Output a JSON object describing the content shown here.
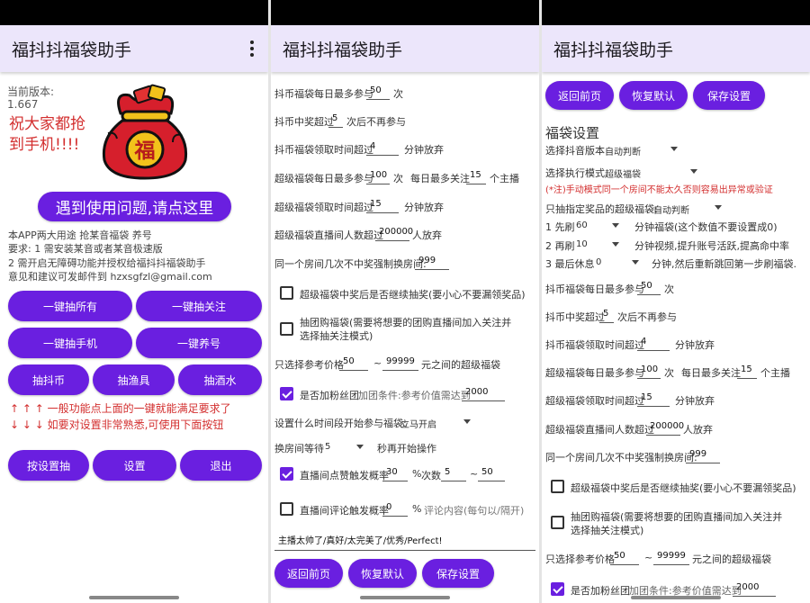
{
  "app_title": "福抖抖福袋助手",
  "colors": {
    "accent": "#6a1fe0",
    "appbar": "#ece6fb",
    "warning": "#d32f2f"
  },
  "icons": {
    "menu": "more-vert-icon",
    "lucky_bag": "lucky-bag-image",
    "checkbox": "checkbox-icon",
    "dropdown": "caret-down-icon"
  },
  "screen1": {
    "version_label": "当前版本:",
    "version": "1.667",
    "greeting": "祝大家都抢到手机!!!!",
    "bag_char": "福",
    "help_button": "遇到使用问题,请点这里",
    "info": [
      "本APP两大用途 抢某音福袋 养号",
      " 要求: 1 需安装某音或者某音极速版",
      " 2 需开启无障碍功能并授权给福抖抖福袋助手",
      " 意见和建议可发邮件到 hzxsgfzl@gmail.com"
    ],
    "btn_all": "一键抽所有",
    "btn_follow": "一键抽关注",
    "btn_phone": "一键抽手机",
    "btn_nurture": "一键养号",
    "btn_dy_coin": "抽抖币",
    "btn_fishing": "抽渔具",
    "btn_liquor": "抽酒水",
    "tip_up": "↑ ↑ ↑ 一般功能点上面的一键就能满足要求了",
    "tip_down": "↓ ↓ ↓ 如要对设置非常熟悉,可使用下面按钮",
    "btn_settings_draw": "按设置抽",
    "btn_settings": "设置",
    "btn_exit": "退出"
  },
  "settings": {
    "daily_limit_pre": "抖币福袋每日最多参与",
    "daily_limit": "50",
    "daily_limit_unit": "次",
    "stop_after_pre": "抖币中奖超过",
    "stop_after": "5",
    "stop_after_post": "次后不再参与",
    "dy_wait_pre": "抖币福袋领取时间超过",
    "dy_wait": "4",
    "dy_wait_post": "分钟放弃",
    "super_daily_pre": "超级福袋每日最多参与",
    "super_daily": "100",
    "super_daily_unit": "次",
    "follow_pre": "每日最多关注",
    "follow_max": "15",
    "follow_post": "个主播",
    "super_wait_pre": "超级福袋领取时间超过",
    "super_wait": "15",
    "super_wait_post": "分钟放弃",
    "viewers_pre": "超级福袋直播间人数超过",
    "viewers": "200000",
    "viewers_post": "人放弃",
    "switch_pre": "同一个房间几次不中奖强制换房间:",
    "switch_after": "999",
    "continue_label": "超级福袋中奖后是否继续抽奖(要小心不要漏领奖品)",
    "group_label": "抽团购福袋(需要将想要的团购直播间加入关注并选择抽关注模式)",
    "price_pre": "只选择参考价格",
    "price_min": "50",
    "price_tilde": "~",
    "price_max": "99999",
    "price_post": "元之间的超级福袋",
    "fans_label": "是否加粉丝团",
    "fans_cond": "加团条件:参考价值需达到",
    "fans_value": "2000",
    "period_label": "设置什么时间段开始参与福袋:",
    "period_value": "立马开启",
    "wait_pre": "换房间等待",
    "wait_value": "5",
    "wait_post": "秒再开始操作",
    "like_label": "直播间点赞触发概率",
    "like_rate": "30",
    "like_pct": "%",
    "like_times": "次数",
    "like_min": "5",
    "like_tilde": "~",
    "like_max": "50",
    "comment_label": "直播间评论触发概率",
    "comment_rate": "0",
    "comment_pct": "%",
    "comment_content": "评论内容(每句以/隔开)",
    "comment_text": "主播太帅了/真好/太完美了/优秀/Perfect!",
    "btn_back": "返回前页",
    "btn_reset": "恢复默认",
    "btn_save": "保存设置"
  },
  "screen3": {
    "section": "福袋设置",
    "version_pre": "选择抖音版本",
    "version_value": "自动判断",
    "mode_pre": "选择执行模式",
    "mode_value": "超级福袋",
    "manual_warn": "(*注)手动模式同一个房间不能太久否则容易出异常或验证",
    "only_pre": "只抽指定奖品的超级福袋:",
    "only_value": "自动判断",
    "r1_pre": "1 先刷",
    "r1_value": "60",
    "r1_post": "分钟福袋(这个数值不要设置成0)",
    "r2_pre": "2 再刷",
    "r2_value": "10",
    "r2_post": "分钟视频,提升账号活跃,提高命中率",
    "r3_pre": "3 最后休息",
    "r3_value": "0",
    "r3_post": "分钟,然后重新跳回第一步刷福袋."
  }
}
